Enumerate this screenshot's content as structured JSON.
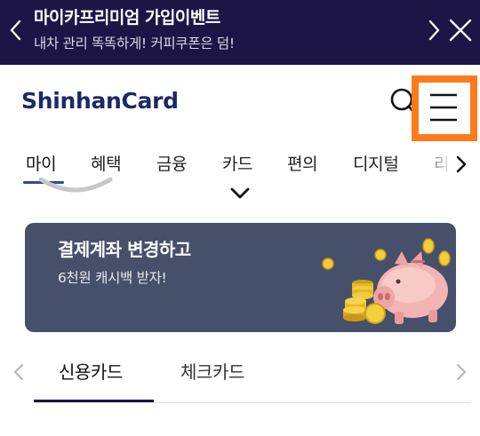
{
  "promo": {
    "title": "마이카프리미엄 가입이벤트",
    "subtitle": "내차 관리 똑똑하게! 커피쿠폰은 덤!",
    "background": "#1d1546"
  },
  "header": {
    "logo": "ShinhanCard",
    "logo_color": "#1b2a65",
    "highlight_color": "#ff7a1a"
  },
  "nav": {
    "items": [
      {
        "label": "마이",
        "active": true
      },
      {
        "label": "혜택"
      },
      {
        "label": "금융"
      },
      {
        "label": "카드"
      },
      {
        "label": "편의"
      },
      {
        "label": "디지털"
      },
      {
        "label": "리"
      }
    ],
    "accent": "#3346a3"
  },
  "banner": {
    "title": "결제계좌 변경하고",
    "description": "6천원 캐시백 받자!",
    "background": "#46506a"
  },
  "card_tabs": {
    "items": [
      {
        "label": "신용카드",
        "active": true
      },
      {
        "label": "체크카드"
      }
    ]
  },
  "icons": {
    "promo_prev": "chevron-left-icon",
    "promo_next": "chevron-right-icon",
    "promo_close": "close-icon",
    "search": "search-icon",
    "menu": "hamburger-menu-icon",
    "nav_next": "chevron-right-icon",
    "expand": "chevron-down-icon",
    "piggy": "piggy-bank-with-coins-icon"
  }
}
